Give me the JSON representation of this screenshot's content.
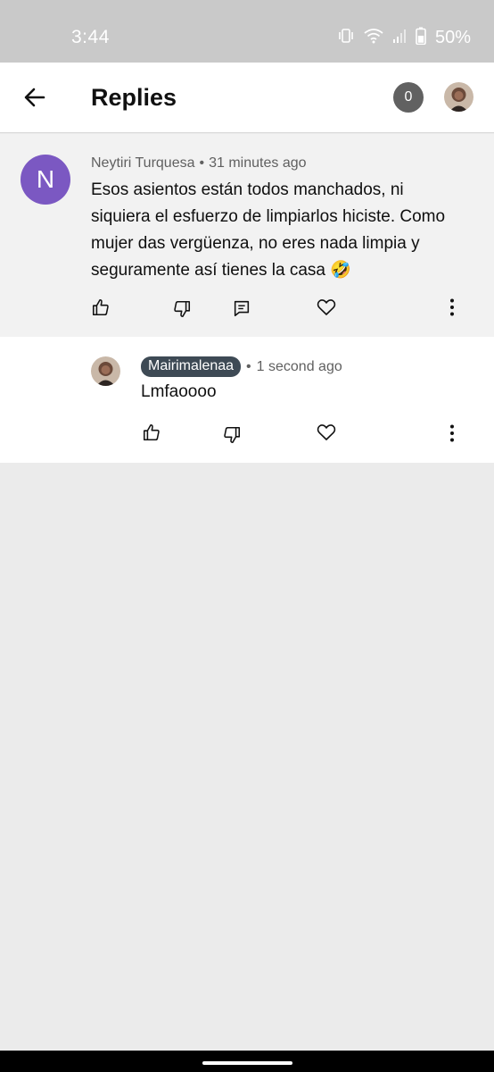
{
  "status_bar": {
    "time": "3:44",
    "battery": "50%",
    "icons": [
      "vibrate-icon",
      "wifi-icon",
      "signal-icon",
      "battery-icon"
    ]
  },
  "header": {
    "title": "Replies",
    "badge_count": "0"
  },
  "parent_comment": {
    "avatar_letter": "N",
    "avatar_color": "#7b58c2",
    "author": "Neytiri Turquesa",
    "separator": "•",
    "time": "31 minutes ago",
    "text": "Esos asientos están todos manchados, ni siquiera el esfuerzo de limpiarlos hiciste. Como mujer das vergüenza, no eres nada limpia y seguramente así tienes la casa 🤣"
  },
  "reply": {
    "author": "Mairimalenaa",
    "separator": "•",
    "time": "1 second ago",
    "text": "Lmfaoooo",
    "author_chip_color": "#3e4a55"
  },
  "colors": {
    "status_bar": "#c9c9c9",
    "parent_background": "#f2f2f2",
    "page_background": "#ebebeb"
  }
}
